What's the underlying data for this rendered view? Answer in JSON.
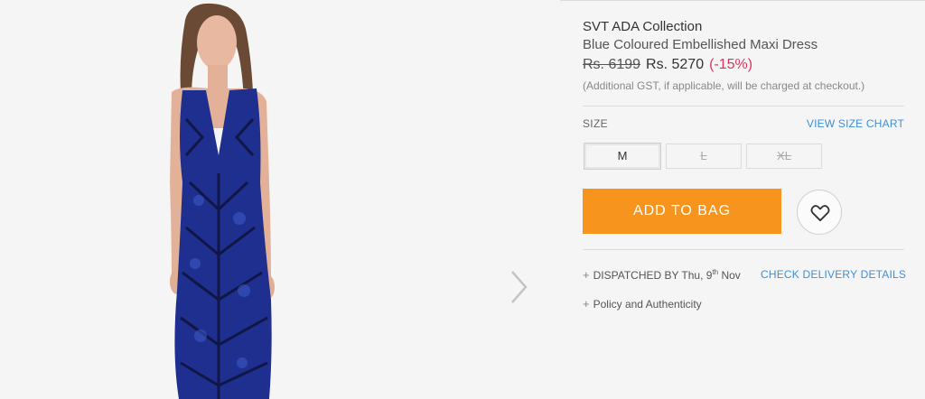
{
  "product": {
    "brand": "SVT ADA Collection",
    "name": "Blue Coloured Embellished Maxi Dress",
    "price_old": "Rs. 6199",
    "price_new": "Rs. 5270",
    "discount": "(-15%)",
    "gst_note": "(Additional GST, if applicable, will be charged at checkout.)"
  },
  "size": {
    "label": "SIZE",
    "chart_link": "VIEW SIZE CHART",
    "options": [
      {
        "label": "M",
        "available": true
      },
      {
        "label": "L",
        "available": false
      },
      {
        "label": "XL",
        "available": false
      }
    ]
  },
  "actions": {
    "add_to_bag": "ADD TO BAG",
    "wishlist_icon": "heart-icon"
  },
  "delivery": {
    "dispatch_prefix": "DISPATCHED BY",
    "dispatch_day": "Thu, 9",
    "dispatch_sup": "th",
    "dispatch_month": "Nov",
    "check_link": "CHECK DELIVERY DETAILS"
  },
  "policy": {
    "label": "Policy and Authenticity"
  },
  "gallery": {
    "next_icon": "chevron-right-icon"
  },
  "colors": {
    "accent": "#f7941d",
    "link": "#3f8fd6",
    "discount": "#e0335f",
    "dress": "#1f2f8f"
  }
}
